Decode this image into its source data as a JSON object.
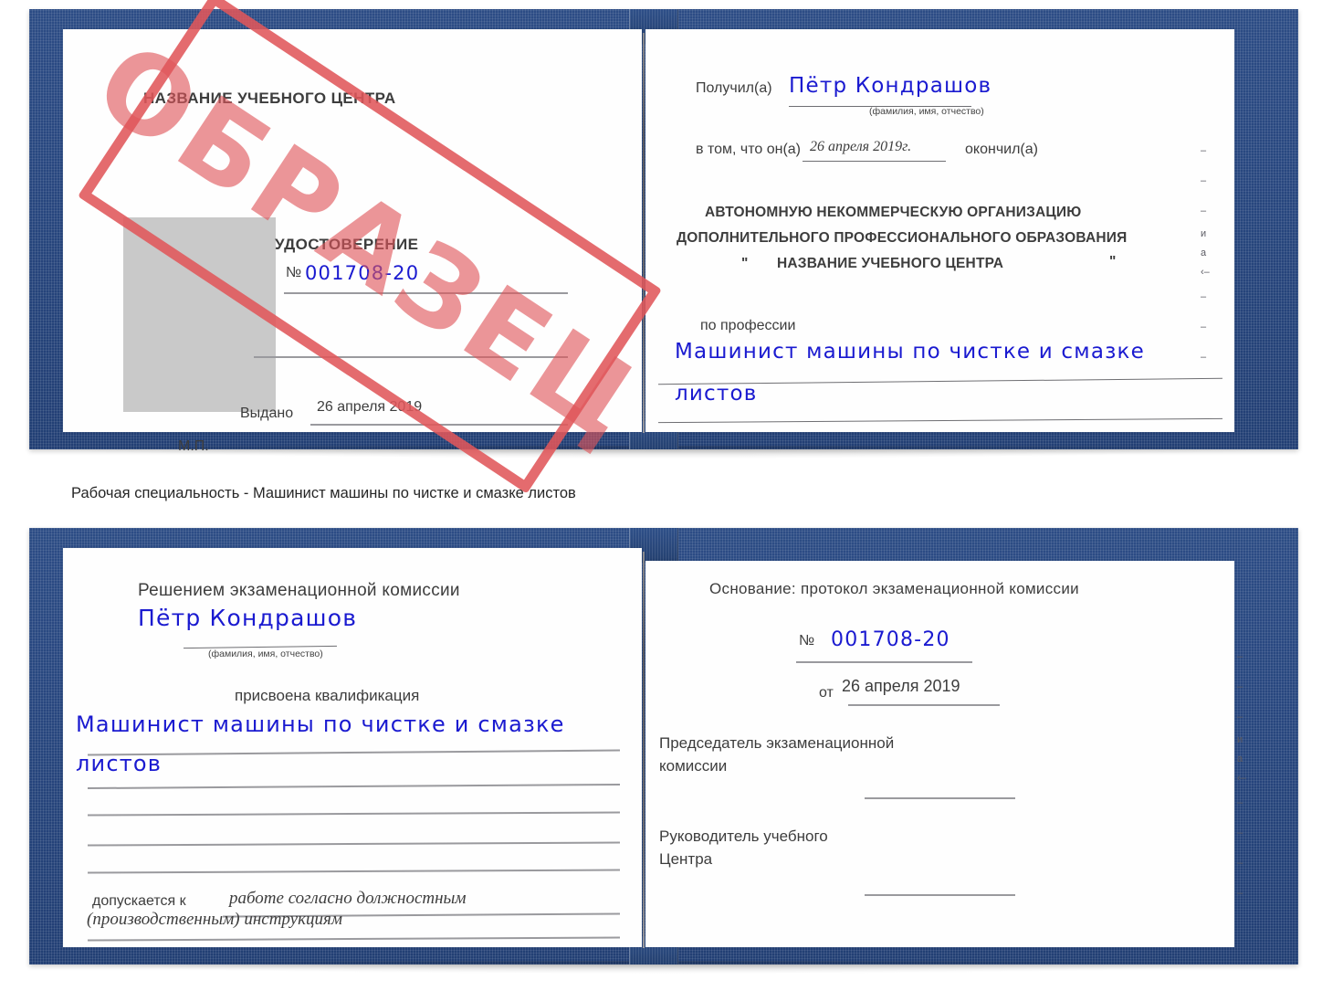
{
  "caption": "Рабочая специальность - Машинист машины по чистке и смазке листов",
  "watermark": {
    "text": "ОБРАЗЕЦ",
    "color": "#e0565a"
  },
  "colors": {
    "cover_blue": "#27467e",
    "handwriting_blue": "#1a1ad0",
    "stamp_red": "#e0565a",
    "photo_placeholder_gray": "#c9c9c9",
    "page_white": "#fefefe",
    "rule_gray": "#9a9a9e"
  },
  "certificate_top": {
    "left_page": {
      "center_name": "НАЗВАНИЕ УЧЕБНОГО ЦЕНТРА",
      "doc_title": "УДОСТОВЕРЕНИЕ",
      "number_label": "№",
      "number_value": "001708-20",
      "issued_label": "Выдано",
      "issued_value": "26 апреля 2019",
      "stamp_place_label": "М.П.",
      "photo_placeholder": "photo-placeholder"
    },
    "right_page": {
      "received_label": "Получил(а)",
      "received_value": "Пётр Кондрашов",
      "received_hint": "(фамилия, имя, отчество)",
      "that_he_label": "в том, что он(а)",
      "completion_date": "26 апреля 2019г.",
      "finished_label": "окончил(а)",
      "org_line1": "АВТОНОМНУЮ НЕКОММЕРЧЕСКУЮ ОРГАНИЗАЦИЮ",
      "org_line2": "ДОПОЛНИТЕЛЬНОГО ПРОФЕССИОНАЛЬНОГО ОБРАЗОВАНИЯ",
      "org_quote_open": "\"",
      "org_line3": "НАЗВАНИЕ УЧЕБНОГО ЦЕНТРА",
      "org_quote_close": "\"",
      "profession_label": "по профессии",
      "profession_line1": "Машинист машины по чистке и смазке",
      "profession_line2": "листов"
    }
  },
  "certificate_bottom": {
    "left_page": {
      "heading": "Решением экзаменационной комиссии",
      "name_value": "Пётр Кондрашов",
      "name_hint": "(фамилия, имя, отчество)",
      "qualification_label": "присвоена квалификация",
      "qualification_line1": "Машинист машины по чистке и смазке",
      "qualification_line2": "листов",
      "admitted_label": "допускается к",
      "admitted_line1": "работе согласно должностным",
      "admitted_line2": "(производственным) инструкциям"
    },
    "right_page": {
      "basis_label": "Основание: протокол экзаменационной комиссии",
      "protocol_number_label": "№",
      "protocol_number_value": "001708-20",
      "protocol_date_label": "от",
      "protocol_date_value": "26 апреля 2019",
      "chairman_line1": "Председатель экзаменационной",
      "chairman_line2": "комиссии",
      "head_line1": "Руководитель учебного",
      "head_line2": "Центра"
    }
  },
  "edge_artifacts": {
    "top": [
      "–",
      "–",
      "–",
      "и",
      "а",
      "‹–",
      "–",
      "–",
      "–"
    ],
    "bottom": [
      "–",
      "–",
      "–",
      "и",
      "а",
      "‹–",
      "–",
      "–",
      "–",
      "–"
    ]
  }
}
